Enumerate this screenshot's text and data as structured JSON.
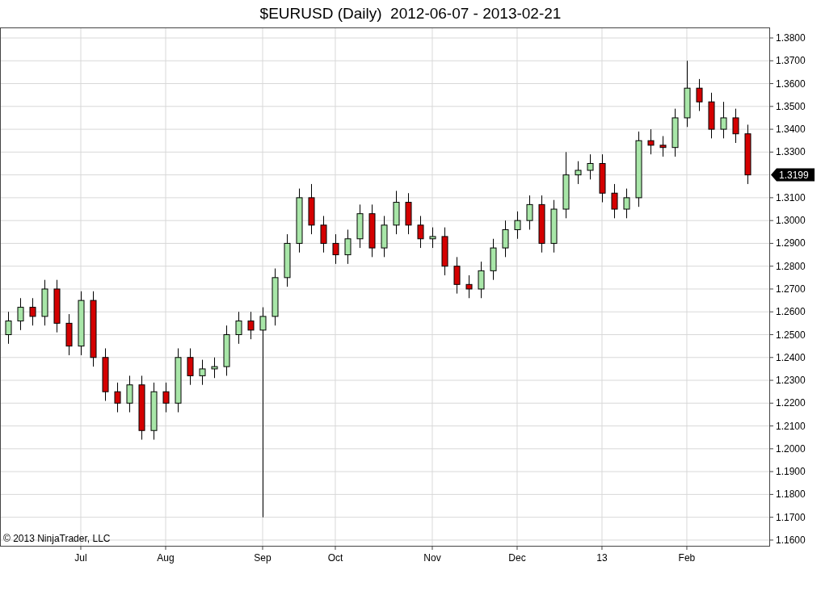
{
  "title": "$EURUSD (Daily)  2012-06-07 - 2013-02-21",
  "chart": {
    "chart_data": {
      "type": "candlestick",
      "categories": [
        null,
        null,
        null,
        null,
        null,
        null,
        "Jul",
        null,
        null,
        null,
        null,
        null,
        null,
        "Aug",
        null,
        null,
        null,
        null,
        null,
        null,
        null,
        "Sep",
        null,
        null,
        null,
        null,
        null,
        "Oct",
        null,
        null,
        null,
        null,
        null,
        null,
        null,
        "Nov",
        null,
        null,
        null,
        null,
        null,
        null,
        "Dec",
        null,
        null,
        null,
        null,
        null,
        null,
        "13",
        null,
        null,
        null,
        null,
        null,
        null,
        "Feb",
        null,
        null,
        null,
        null,
        null
      ],
      "ohlc": [
        [
          1.25,
          1.26,
          1.246,
          1.256
        ],
        [
          1.256,
          1.266,
          1.252,
          1.262
        ],
        [
          1.262,
          1.266,
          1.254,
          1.258
        ],
        [
          1.258,
          1.274,
          1.254,
          1.27
        ],
        [
          1.27,
          1.274,
          1.251,
          1.255
        ],
        [
          1.255,
          1.259,
          1.241,
          1.245
        ],
        [
          1.245,
          1.269,
          1.241,
          1.265
        ],
        [
          1.265,
          1.269,
          1.236,
          1.24
        ],
        [
          1.24,
          1.244,
          1.221,
          1.225
        ],
        [
          1.225,
          1.229,
          1.216,
          1.22
        ],
        [
          1.22,
          1.232,
          1.216,
          1.228
        ],
        [
          1.228,
          1.232,
          1.204,
          1.208
        ],
        [
          1.208,
          1.229,
          1.204,
          1.225
        ],
        [
          1.225,
          1.229,
          1.216,
          1.22
        ],
        [
          1.22,
          1.244,
          1.216,
          1.24
        ],
        [
          1.24,
          1.244,
          1.228,
          1.232
        ],
        [
          1.232,
          1.239,
          1.228,
          1.235
        ],
        [
          1.235,
          1.24,
          1.231,
          1.236
        ],
        [
          1.236,
          1.254,
          1.232,
          1.25
        ],
        [
          1.25,
          1.26,
          1.246,
          1.256
        ],
        [
          1.256,
          1.26,
          1.248,
          1.252
        ],
        [
          1.252,
          1.262,
          1.17,
          1.258
        ],
        [
          1.258,
          1.279,
          1.254,
          1.275
        ],
        [
          1.275,
          1.294,
          1.271,
          1.29
        ],
        [
          1.29,
          1.314,
          1.286,
          1.31
        ],
        [
          1.31,
          1.316,
          1.294,
          1.298
        ],
        [
          1.298,
          1.302,
          1.286,
          1.29
        ],
        [
          1.29,
          1.294,
          1.281,
          1.285
        ],
        [
          1.285,
          1.296,
          1.281,
          1.292
        ],
        [
          1.292,
          1.307,
          1.288,
          1.303
        ],
        [
          1.303,
          1.307,
          1.284,
          1.288
        ],
        [
          1.288,
          1.302,
          1.284,
          1.298
        ],
        [
          1.298,
          1.313,
          1.294,
          1.308
        ],
        [
          1.308,
          1.312,
          1.294,
          1.298
        ],
        [
          1.298,
          1.302,
          1.288,
          1.292
        ],
        [
          1.292,
          1.297,
          1.288,
          1.293
        ],
        [
          1.293,
          1.297,
          1.276,
          1.28
        ],
        [
          1.28,
          1.284,
          1.268,
          1.272
        ],
        [
          1.272,
          1.276,
          1.266,
          1.27
        ],
        [
          1.27,
          1.282,
          1.266,
          1.278
        ],
        [
          1.278,
          1.292,
          1.274,
          1.288
        ],
        [
          1.288,
          1.3,
          1.284,
          1.296
        ],
        [
          1.296,
          1.304,
          1.292,
          1.3
        ],
        [
          1.3,
          1.311,
          1.296,
          1.307
        ],
        [
          1.307,
          1.311,
          1.286,
          1.29
        ],
        [
          1.29,
          1.309,
          1.286,
          1.305
        ],
        [
          1.305,
          1.33,
          1.301,
          1.32
        ],
        [
          1.32,
          1.326,
          1.316,
          1.322
        ],
        [
          1.322,
          1.329,
          1.318,
          1.325
        ],
        [
          1.325,
          1.329,
          1.308,
          1.312
        ],
        [
          1.312,
          1.316,
          1.301,
          1.305
        ],
        [
          1.305,
          1.314,
          1.301,
          1.31
        ],
        [
          1.31,
          1.339,
          1.306,
          1.335
        ],
        [
          1.335,
          1.34,
          1.329,
          1.333
        ],
        [
          1.333,
          1.337,
          1.328,
          1.332
        ],
        [
          1.332,
          1.349,
          1.328,
          1.345
        ],
        [
          1.345,
          1.37,
          1.341,
          1.358
        ],
        [
          1.358,
          1.362,
          1.348,
          1.352
        ],
        [
          1.352,
          1.356,
          1.336,
          1.34
        ],
        [
          1.34,
          1.352,
          1.336,
          1.345
        ],
        [
          1.345,
          1.349,
          1.334,
          1.338
        ],
        [
          1.338,
          1.342,
          1.316,
          1.32
        ]
      ],
      "ylim": [
        1.1575,
        1.3846
      ],
      "grid": true,
      "yticks": [
        {
          "value": 1.16,
          "label": "1.1600"
        },
        {
          "value": 1.17,
          "label": "1.1700"
        },
        {
          "value": 1.18,
          "label": "1.1800"
        },
        {
          "value": 1.19,
          "label": "1.1900"
        },
        {
          "value": 1.2,
          "label": "1.2000"
        },
        {
          "value": 1.21,
          "label": "1.2100"
        },
        {
          "value": 1.22,
          "label": "1.2200"
        },
        {
          "value": 1.23,
          "label": "1.2300"
        },
        {
          "value": 1.24,
          "label": "1.2400"
        },
        {
          "value": 1.25,
          "label": "1.2500"
        },
        {
          "value": 1.26,
          "label": "1.2600"
        },
        {
          "value": 1.27,
          "label": "1.2700"
        },
        {
          "value": 1.28,
          "label": "1.2800"
        },
        {
          "value": 1.29,
          "label": "1.2900"
        },
        {
          "value": 1.3,
          "label": "1.3000"
        },
        {
          "value": 1.31,
          "label": "1.3100"
        },
        {
          "value": 1.33,
          "label": "1.3300"
        },
        {
          "value": 1.34,
          "label": "1.3400"
        },
        {
          "value": 1.35,
          "label": "1.3500"
        },
        {
          "value": 1.36,
          "label": "1.3600"
        },
        {
          "value": 1.37,
          "label": "1.3700"
        },
        {
          "value": 1.38,
          "label": "1.3800"
        }
      ]
    },
    "last_price": "1.3199",
    "copyright": "© 2013 NinjaTrader, LLC"
  }
}
